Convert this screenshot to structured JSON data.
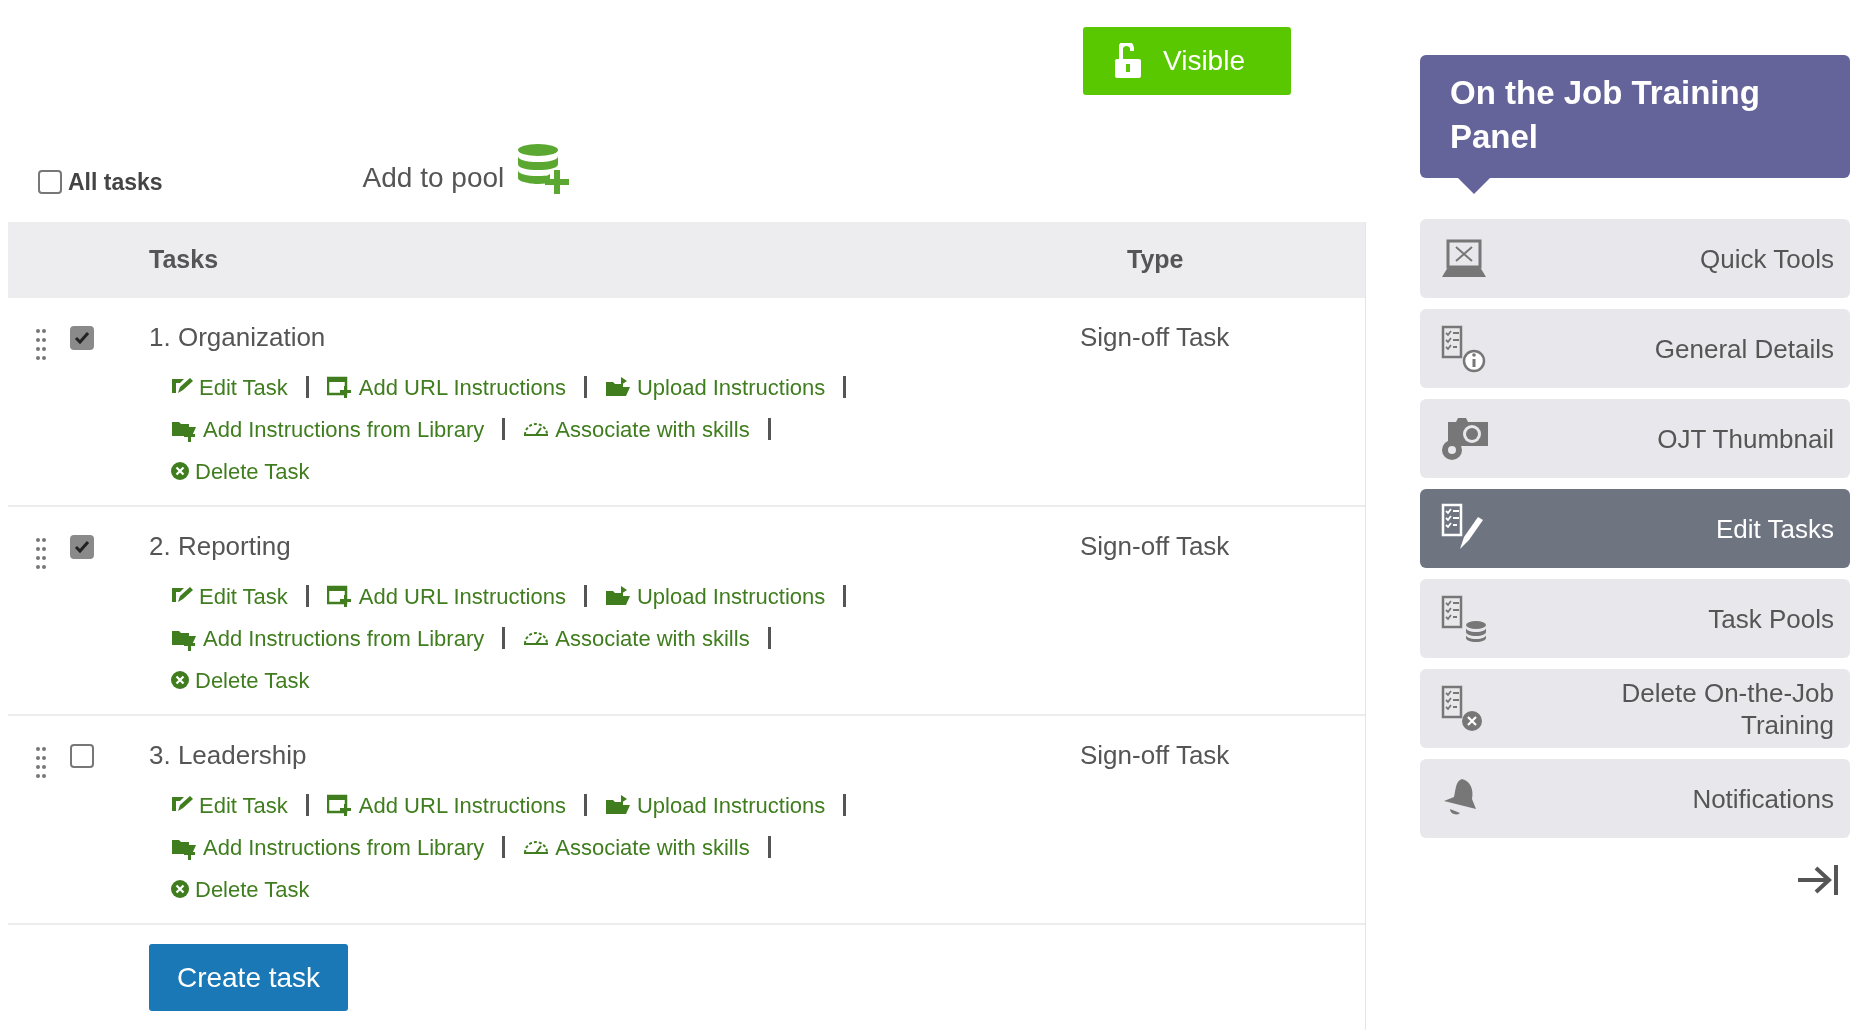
{
  "visibility_button": {
    "label": "Visible"
  },
  "select_all": {
    "label": "All tasks",
    "checked": false
  },
  "add_to_pool": {
    "label": "Add to pool"
  },
  "table": {
    "columns": [
      "Tasks",
      "Type"
    ],
    "rows": [
      {
        "title": "1. Organization",
        "type": "Sign-off Task",
        "checked": true,
        "action_lines": [
          [
            {
              "kind": "edit",
              "label": "Edit Task"
            },
            {
              "kind": "url",
              "label": "Add URL Instructions"
            },
            {
              "kind": "upload",
              "label": "Upload Instructions"
            }
          ],
          [
            {
              "kind": "library",
              "label": "Add Instructions from Library"
            },
            {
              "kind": "skills",
              "label": "Associate with skills"
            }
          ],
          [
            {
              "kind": "delete",
              "label": "Delete Task"
            }
          ]
        ]
      },
      {
        "title": "2. Reporting",
        "type": "Sign-off Task",
        "checked": true,
        "action_lines": [
          [
            {
              "kind": "edit",
              "label": "Edit Task"
            },
            {
              "kind": "url",
              "label": "Add URL Instructions"
            },
            {
              "kind": "upload",
              "label": "Upload Instructions"
            }
          ],
          [
            {
              "kind": "library",
              "label": "Add Instructions from Library"
            },
            {
              "kind": "skills",
              "label": "Associate with skills"
            }
          ],
          [
            {
              "kind": "delete",
              "label": "Delete Task"
            }
          ]
        ]
      },
      {
        "title": "3. Leadership",
        "type": "Sign-off Task",
        "checked": false,
        "action_lines": [
          [
            {
              "kind": "edit",
              "label": "Edit Task"
            },
            {
              "kind": "url",
              "label": "Add URL Instructions"
            },
            {
              "kind": "upload",
              "label": "Upload Instructions"
            }
          ],
          [
            {
              "kind": "library",
              "label": "Add Instructions from Library"
            },
            {
              "kind": "skills",
              "label": "Associate with skills"
            }
          ],
          [
            {
              "kind": "delete",
              "label": "Delete Task"
            }
          ]
        ]
      }
    ]
  },
  "create_button": {
    "label": "Create task"
  },
  "panel": {
    "title": "On the Job Training Panel",
    "items": [
      {
        "kind": "quick-tools",
        "label": "Quick Tools",
        "selected": false
      },
      {
        "kind": "general",
        "label": "General Details",
        "selected": false
      },
      {
        "kind": "thumbnail",
        "label": "OJT Thumbnail",
        "selected": false
      },
      {
        "kind": "edit-tasks",
        "label": "Edit Tasks",
        "selected": true
      },
      {
        "kind": "pools",
        "label": "Task Pools",
        "selected": false
      },
      {
        "kind": "delete",
        "label": "Delete On-the-Job Training",
        "selected": false
      },
      {
        "kind": "notifications",
        "label": "Notifications",
        "selected": false
      }
    ]
  }
}
